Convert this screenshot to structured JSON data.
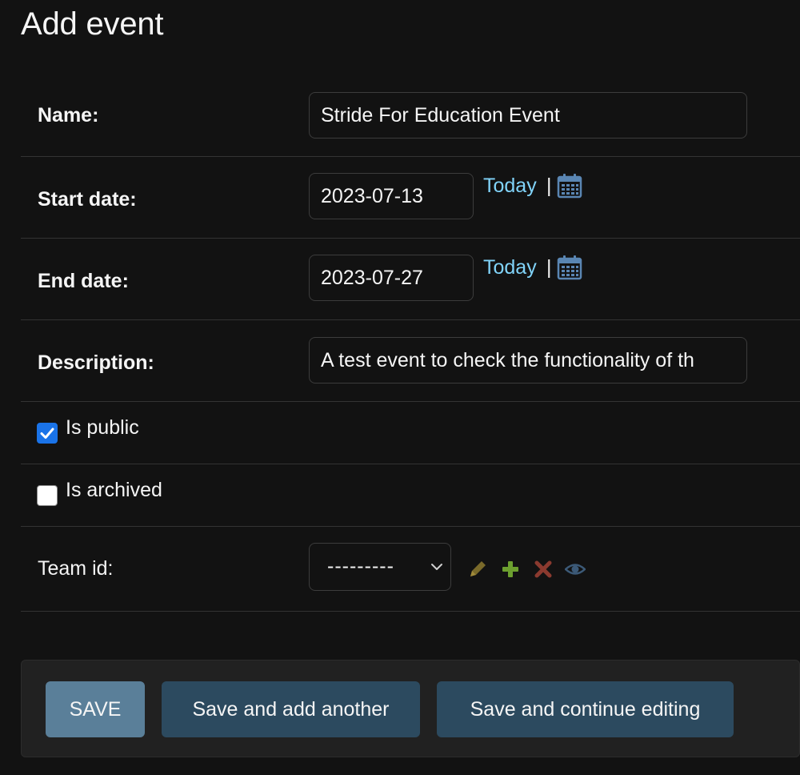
{
  "page": {
    "title": "Add event"
  },
  "fields": {
    "name": {
      "label": "Name:",
      "value": "Stride For Education Event"
    },
    "start_date": {
      "label": "Start date:",
      "value": "2023-07-13",
      "today_label": "Today",
      "separator": "|",
      "icon": "calendar-icon"
    },
    "end_date": {
      "label": "End date:",
      "value": "2023-07-27",
      "today_label": "Today",
      "separator": "|",
      "icon": "calendar-icon"
    },
    "description": {
      "label": "Description:",
      "value": "A test event to check the functionality of th"
    },
    "is_public": {
      "label": "Is public",
      "checked": true
    },
    "is_archived": {
      "label": "Is archived",
      "checked": false
    },
    "team_id": {
      "label": "Team id:",
      "selected": "---------",
      "icons": [
        "edit-pencil-icon",
        "add-plus-icon",
        "delete-x-icon",
        "view-eye-icon"
      ]
    }
  },
  "submit_row": {
    "save_label": "SAVE",
    "save_add_another_label": "Save and add another",
    "save_continue_label": "Save and continue editing"
  },
  "colors": {
    "background": "#121212",
    "link": "#81d4fa",
    "checkbox_checked": "#1a73e8",
    "button_default": "#5a7f99",
    "button_secondary": "#2c4a5f",
    "add_icon": "#6c9f2f",
    "delete_icon": "#8b3a2f",
    "edit_icon": "#7a6a2a",
    "view_icon": "#3c5a78"
  }
}
